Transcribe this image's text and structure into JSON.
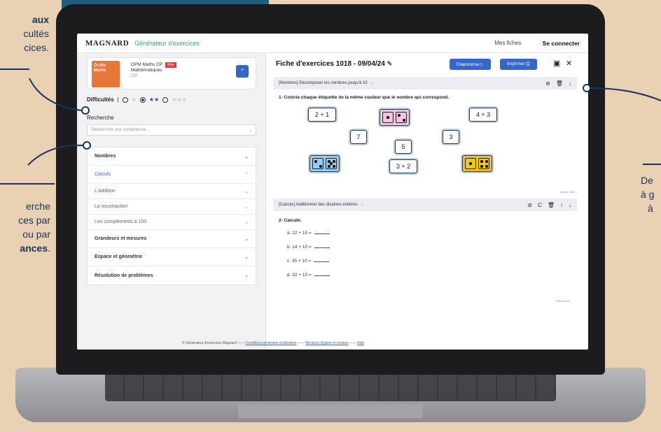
{
  "callouts": {
    "left_top": {
      "line1": "aux",
      "line2": "cultés",
      "line3": "cices."
    },
    "left_mid": {
      "line1": "erche",
      "line2": "ces par",
      "line3": "ou par",
      "line4": "ances",
      "line4_suffix": "."
    },
    "right": {
      "line1": "De",
      "line2": "à g",
      "line3": "à"
    }
  },
  "app": {
    "brand": "MAGNARD",
    "generator": "Générateur d'exercices",
    "nav": {
      "sheets": "Mes fiches",
      "login": "Se connecter"
    }
  },
  "sidebar": {
    "book": {
      "cover_line1": "Outils",
      "cover_line2": "Maths",
      "title1": "OPM Maths CP",
      "badge": "Mes",
      "title2": "Mathématiques",
      "level": "CP"
    },
    "difficulty_label": "Difficultés",
    "search_label": "Recherche",
    "search_placeholder": "Rechercher une compétence...",
    "menu": [
      {
        "label": "Nombres",
        "type": "main"
      },
      {
        "label": "Calculs",
        "type": "open"
      },
      {
        "label": "L'addition",
        "type": "sub"
      },
      {
        "label": "La soustraction",
        "type": "sub"
      },
      {
        "label": "Les compléments à 100",
        "type": "sub"
      },
      {
        "label": "Grandeurs et mesures",
        "type": "main"
      },
      {
        "label": "Espace et géométrie",
        "type": "main"
      },
      {
        "label": "Résolution de problèmes",
        "type": "main"
      }
    ]
  },
  "main": {
    "title": "Fiche d'exercices 1018 - 09/04/24",
    "buttons": {
      "slideshow": "Diaporama",
      "print": "Imprimer"
    },
    "exercise1": {
      "header": "[Nombres] Décomposer les nombres jusqu'à 10",
      "question": "1- Colorie chaque étiquette de la même couleur que le nombre qui correspond.",
      "tiles": [
        "2 + 1",
        "4 + 3",
        "7",
        "3",
        "5",
        "3 + 2"
      ],
      "note": "Fichier 100"
    },
    "exercise2": {
      "header": "[Calculs] Additionner des dizaines entières",
      "question": "2- Calcule.",
      "items": [
        "a. 12 + 10 =",
        "b. 14 + 10 =",
        "c. 35 + 10 =",
        "d. 32 + 10 ="
      ],
      "note": "Fichier 100"
    }
  },
  "footer": {
    "copyright": "© Générateur d'exercices Magnard",
    "terms": "Conditions générales d'utilisation",
    "legal": "Mentions légales et cookies",
    "help": "Aide"
  },
  "colors": {
    "navy": "#17345c",
    "background": "#ead1b4",
    "accent_blue": "#3566c8",
    "brand_green": "#3ea06a"
  }
}
